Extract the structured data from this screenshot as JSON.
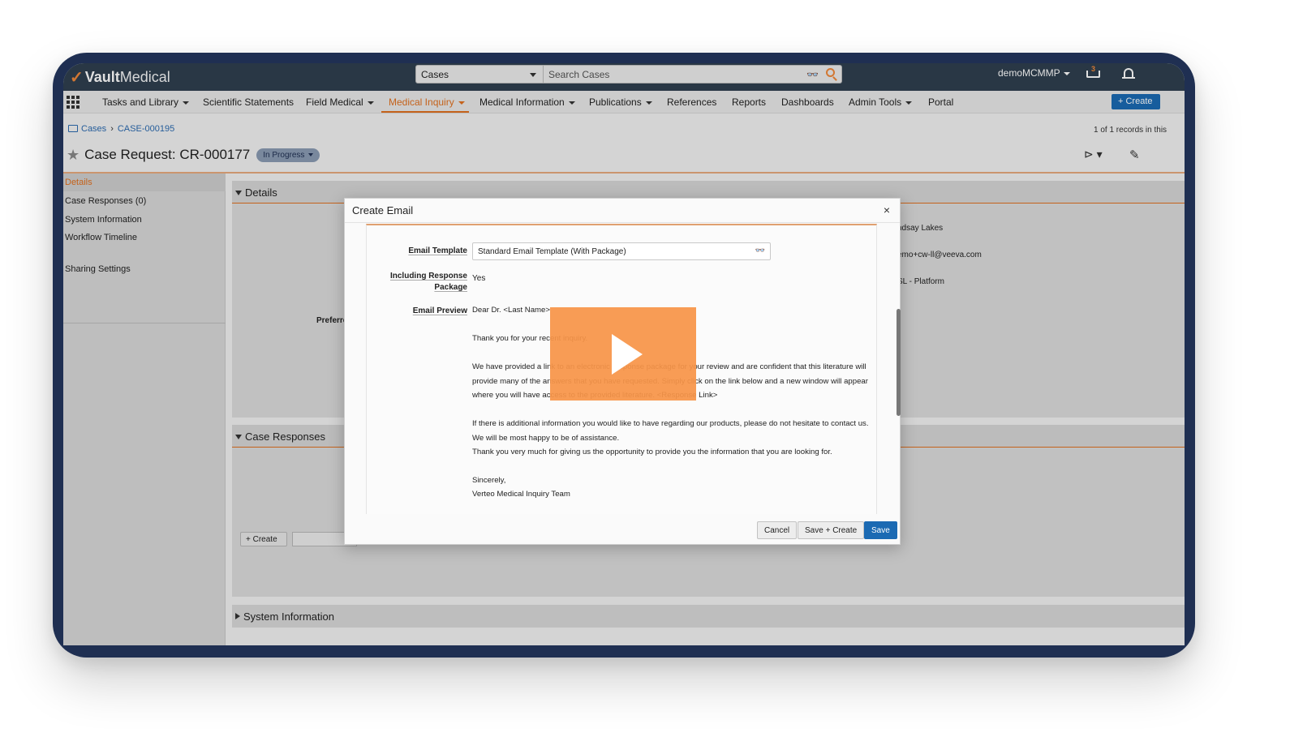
{
  "app": {
    "logo_brand": "Vault",
    "logo_product": "Medical",
    "search_scope": "Cases",
    "search_placeholder": "Search Cases",
    "user": "demoMCMMP",
    "cart_count": "3"
  },
  "nav": {
    "items": [
      {
        "label": "Tasks and Library",
        "dropdown": true
      },
      {
        "label": "Scientific Statements",
        "dropdown": false
      },
      {
        "label": "Field Medical",
        "dropdown": true
      },
      {
        "label": "Medical Inquiry",
        "dropdown": true,
        "active": true
      },
      {
        "label": "Medical Information",
        "dropdown": true
      },
      {
        "label": "Publications",
        "dropdown": true
      },
      {
        "label": "References",
        "dropdown": false
      },
      {
        "label": "Reports",
        "dropdown": false
      },
      {
        "label": "Dashboards",
        "dropdown": false
      },
      {
        "label": "Admin Tools",
        "dropdown": true
      },
      {
        "label": "Portal",
        "dropdown": false
      }
    ],
    "create_label": "+ Create"
  },
  "page": {
    "breadcrumb_root": "Cases",
    "breadcrumb_case": "CASE-000195",
    "records": "1 of 1 records in this",
    "title": "Case Request: CR-000177",
    "status": "In Progress"
  },
  "sidebar": {
    "items": [
      "Details",
      "Case Responses (0)",
      "System Information",
      "Workflow Timeline"
    ],
    "sharing": "Sharing Settings"
  },
  "main": {
    "details_header": "Details",
    "case_responses_header": "Case Responses",
    "system_info_header": "System Information",
    "detail_values": [
      "ndsay Lakes",
      "emo+cw-ll@veeva.com",
      "SL - Platform"
    ],
    "preferred_label": "Preferre",
    "create_label": "+ Create"
  },
  "modal": {
    "title": "Create Email",
    "close": "×",
    "email_template_label": "Email Template",
    "email_template_value": "Standard Email Template (With Package)",
    "including_label_1": "Including Response",
    "including_label_2": "Package",
    "including_value": "Yes",
    "email_preview_label": "Email Preview",
    "preview_lines": [
      "Dear Dr. <Last Name>",
      "",
      "Thank you for your recent inquiry.",
      "",
      "We have provided a link to an electronic response package for your review and are confident that this literature will",
      "provide many of the answers that you have requested. Simply click on the link below and a new window will appear",
      "where you will have access to the provided literature. <Response Link>",
      "",
      "If there is additional information you would like to have regarding our products, please do not hesitate to contact us.",
      "We will be most happy to be of assistance.",
      "Thank you very much for giving us the opportunity to provide you the information that you are looking for.",
      "",
      "Sincerely,",
      "Verteo Medical Inquiry Team"
    ],
    "cancel": "Cancel",
    "save_create": "Save + Create",
    "save": "Save"
  },
  "colors": {
    "frame": "#1f2f52",
    "accent": "#e0701f",
    "primary_button": "#1b6ab3",
    "video_overlay": "#f89548"
  }
}
